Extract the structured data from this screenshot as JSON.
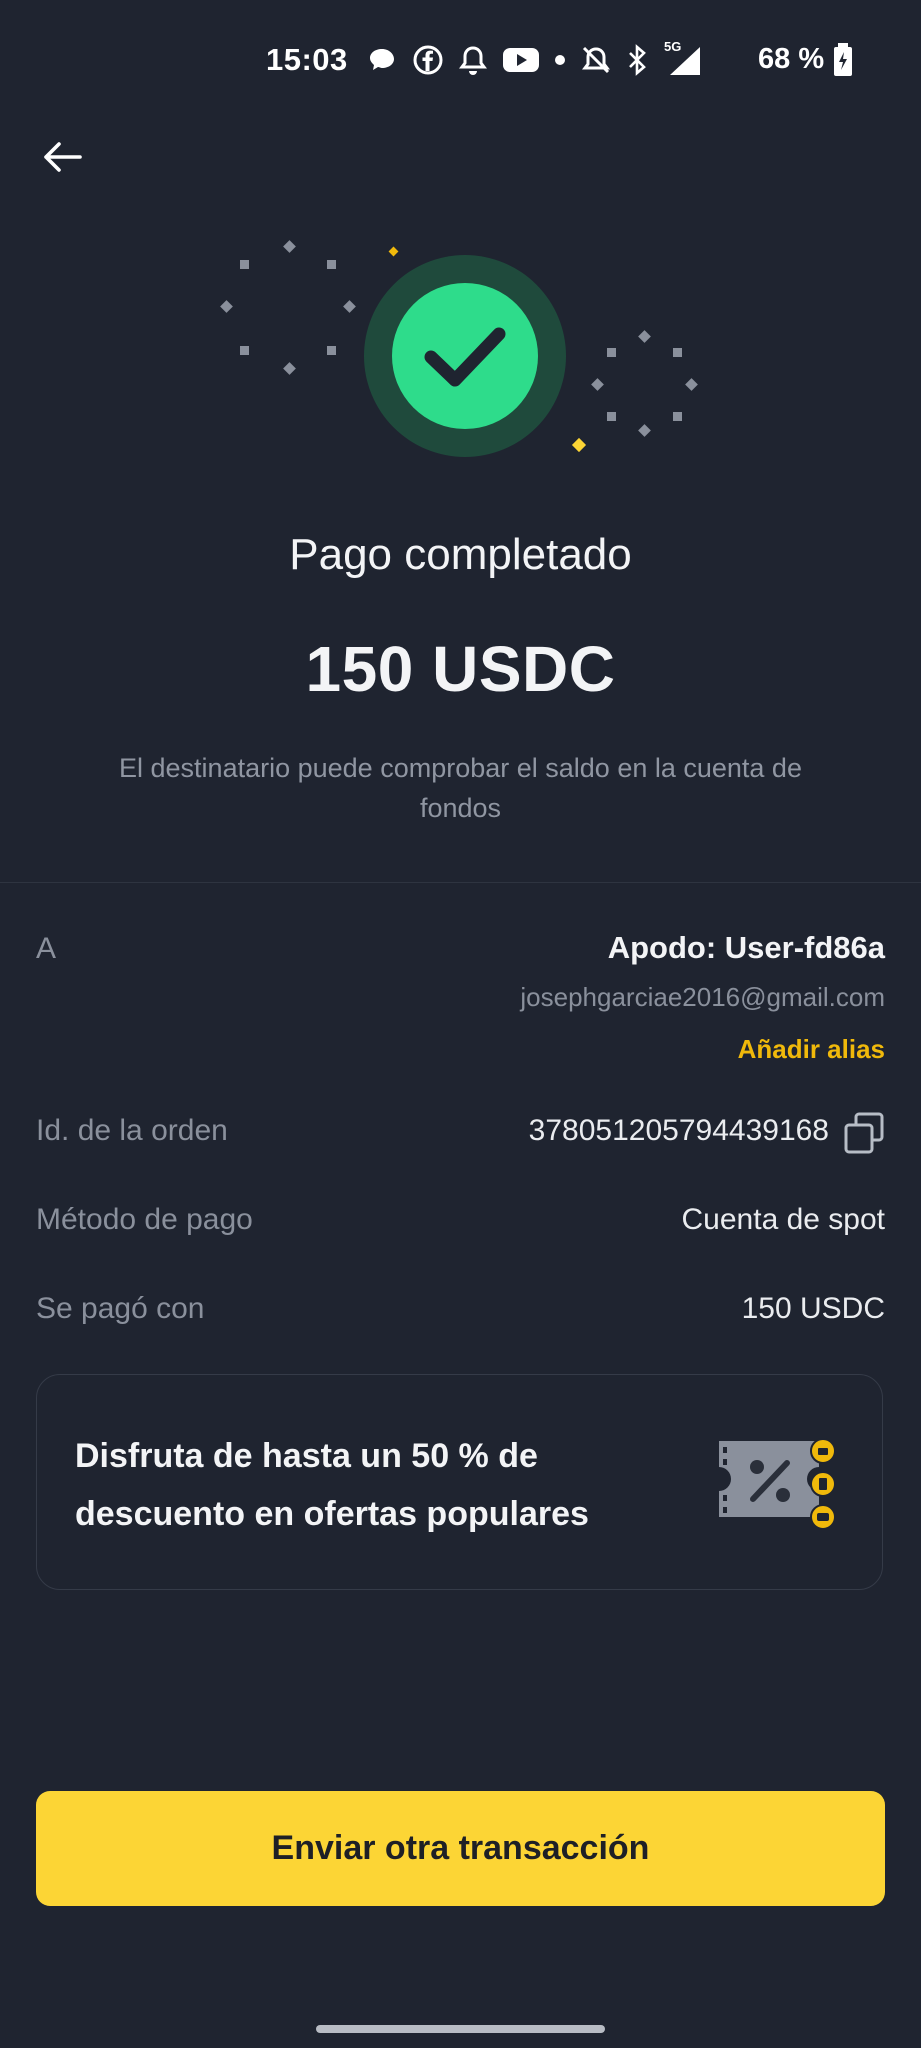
{
  "status_bar": {
    "time": "15:03",
    "network": "5G",
    "battery": "68 %",
    "icons": [
      "chat-bubble-icon",
      "facebook-icon",
      "bell-icon",
      "youtube-icon",
      "dot-icon",
      "bell-off-icon",
      "bluetooth-icon",
      "signal-icon",
      "battery-icon"
    ]
  },
  "header": {
    "back_icon": "arrow-left-icon"
  },
  "result": {
    "icon": "check-circle-icon",
    "title": "Pago completado",
    "amount": "150 USDC",
    "description": "El destinatario puede comprobar el saldo en la cuenta de fondos"
  },
  "details": {
    "recipient_label": "A",
    "nickname": "Apodo: User-fd86a",
    "email": "josephgarciae2016@gmail.com",
    "add_alias": "Añadir alias",
    "order_label": "Id. de la orden",
    "order_id": "378051205794439168",
    "copy_icon": "copy-icon",
    "method_label": "Método de pago",
    "method_value": "Cuenta de spot",
    "paid_label": "Se pagó con",
    "paid_value": "150 USDC"
  },
  "promo": {
    "text": "Disfruta de hasta un 50 % de descuento en ofertas populares",
    "icon": "discount-ticket-icon"
  },
  "cta": {
    "label": "Enviar otra transacción"
  },
  "colors": {
    "background": "#1f2430",
    "accent_yellow": "#fcd535",
    "link_yellow": "#f0b90b",
    "success_green": "#2edc8b",
    "muted_text": "#8a909c"
  }
}
